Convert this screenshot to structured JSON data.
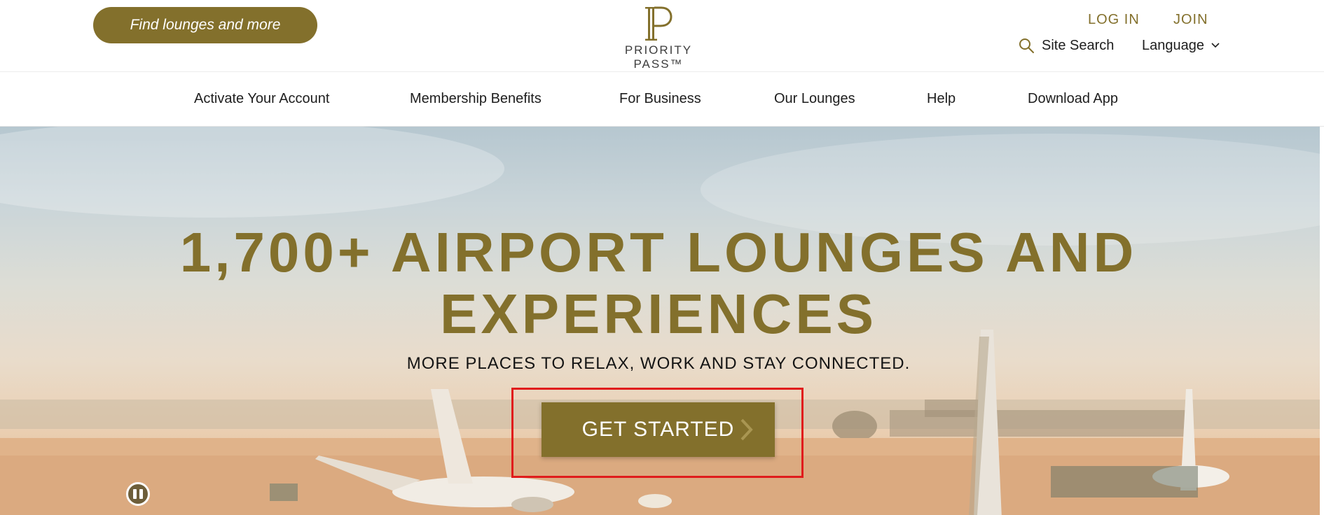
{
  "header": {
    "find_button": "Find lounges and more",
    "logo_text": "PRIORITY PASS™",
    "login": "LOG IN",
    "join": "JOIN",
    "site_search": "Site Search",
    "language": "Language",
    "icons": {
      "search": "search-icon",
      "language_caret": "chevron-down-icon"
    }
  },
  "nav": {
    "items": [
      "Activate Your Account",
      "Membership Benefits",
      "For Business",
      "Our Lounges",
      "Help",
      "Download App"
    ]
  },
  "hero": {
    "title_line1": "1,700+ AIRPORT LOUNGES AND",
    "title_line2": "EXPERIENCES",
    "subtitle": "MORE PLACES TO RELAX, WORK AND STAY CONNECTED.",
    "cta": "GET STARTED",
    "icons": {
      "cta": "chevron-right-icon",
      "carousel": "pause-icon"
    }
  },
  "colors": {
    "brand_gold": "#83702c",
    "highlight_red": "#e01c1c",
    "text_dark": "#1e1e1e"
  }
}
